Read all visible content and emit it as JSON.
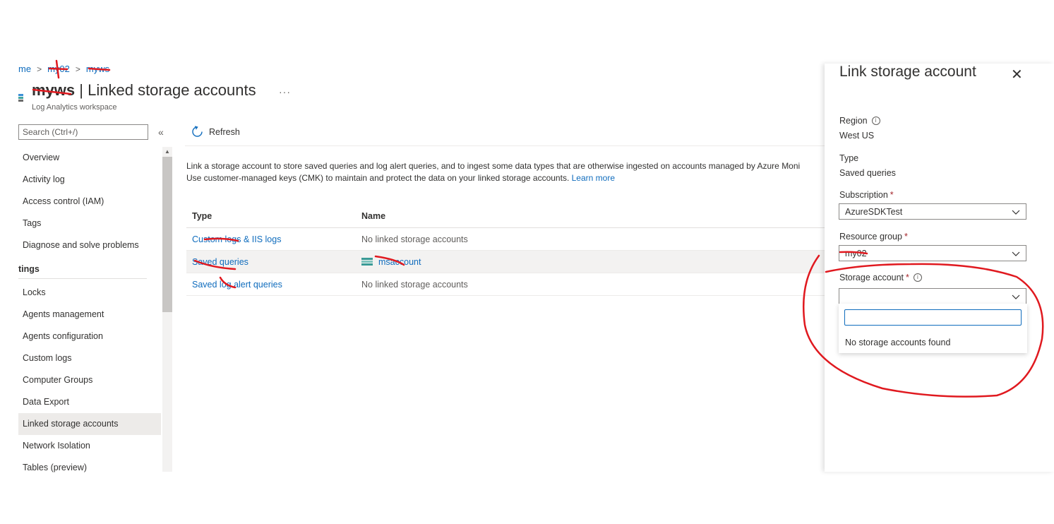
{
  "breadcrumb": {
    "item1": "me",
    "item2": "my02",
    "item3": "myws"
  },
  "header": {
    "workspace_name": "myws",
    "separator": "|",
    "page_title": "Linked storage accounts",
    "more": "···",
    "subtitle": "Log Analytics workspace"
  },
  "sidebar": {
    "search_placeholder": "Search (Ctrl+/)",
    "collapse": "«",
    "items_top": [
      {
        "label": "Overview"
      },
      {
        "label": "Activity log"
      },
      {
        "label": "Access control (IAM)"
      },
      {
        "label": "Tags"
      },
      {
        "label": "Diagnose and solve problems"
      }
    ],
    "section_header": "tings",
    "items_settings": [
      {
        "label": "Locks"
      },
      {
        "label": "Agents management"
      },
      {
        "label": "Agents configuration"
      },
      {
        "label": "Custom logs"
      },
      {
        "label": "Computer Groups"
      },
      {
        "label": "Data Export"
      },
      {
        "label": "Linked storage accounts"
      },
      {
        "label": "Network Isolation"
      },
      {
        "label": "Tables (preview)"
      }
    ],
    "active_item": "Linked storage accounts"
  },
  "toolbar": {
    "refresh_label": "Refresh",
    "refresh_icon": "refresh-icon"
  },
  "main": {
    "description_line1": "Link a storage account to store saved queries and log alert queries, and to ingest some data types that are otherwise ingested on accounts managed by Azure Moni",
    "description_line2": "Use customer-managed keys (CMK) to maintain and protect the data on your linked storage accounts.",
    "learn_more": "Learn more",
    "table": {
      "columns": [
        "Type",
        "Name"
      ],
      "rows": [
        {
          "type": "Custom logs & IIS logs",
          "name": "No linked storage accounts"
        },
        {
          "type": "Saved queries",
          "name": "msaccount"
        },
        {
          "type": "Saved log alert queries",
          "name": "No linked storage accounts"
        }
      ]
    }
  },
  "blade": {
    "title": "Link storage account",
    "close": "✕",
    "region_label": "Region",
    "region_value": "West US",
    "type_label": "Type",
    "type_value": "Saved queries",
    "subscription_label": "Subscription",
    "subscription_value": "AzureSDKTest",
    "resource_group_label": "Resource group",
    "resource_group_value": "my02",
    "storage_account_label": "Storage account",
    "storage_account_value": "",
    "required_marker": "*",
    "info": "i",
    "flyout_message": "No storage accounts found"
  },
  "colors": {
    "link": "#0f6cbd",
    "annotation": "#e0191f",
    "required": "#a4262c"
  }
}
